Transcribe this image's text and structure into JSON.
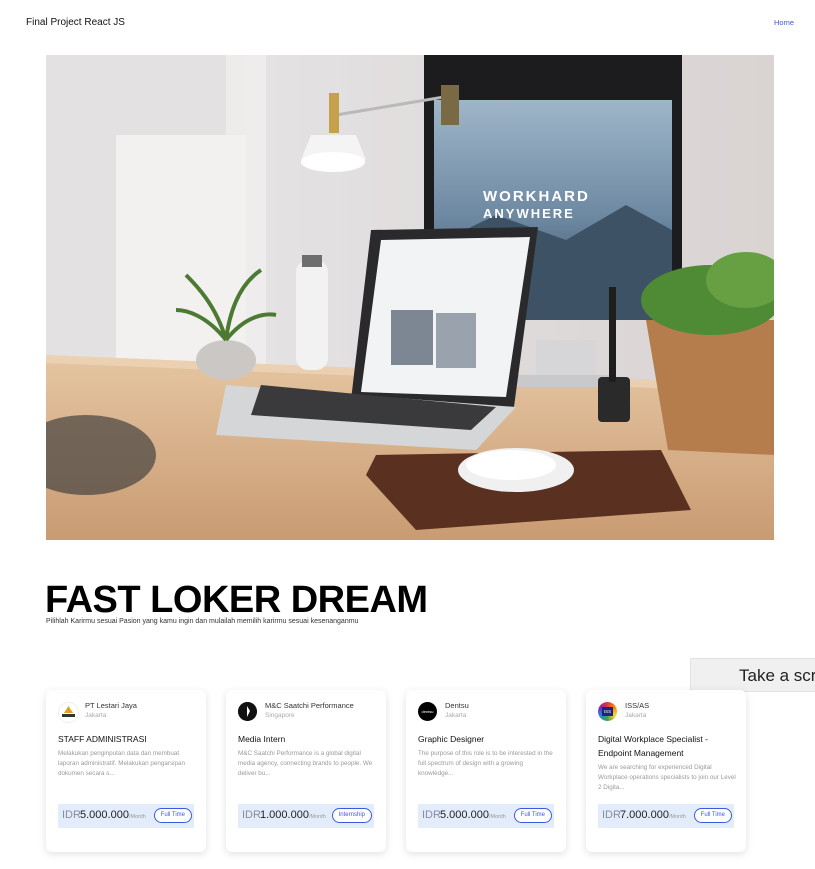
{
  "navbar": {
    "brand": "Final Project React JS",
    "home": "Home"
  },
  "hero": {
    "screen_text_line1": "WORKHARD",
    "screen_text_line2": "ANYWHERE"
  },
  "headline": {
    "title": "FAST LOKER DREAM",
    "subtitle": "Pilihlah Karirmu sesuai Pasion yang kamu ingin dan mulailah memilih karirmu sesuai kesenanganmu"
  },
  "screenshot_button": "Take a scr",
  "jobs": [
    {
      "company": "PT Lestari Jaya",
      "logo_text": "LESTARI",
      "location": "Jakarta",
      "title": "STAFF ADMINISTRASI",
      "description": "Melakukan penginputan data dan membuat laporan administratif. Melakukan pengarsipan dokumen secara s...",
      "currency": "IDR",
      "salary": "5.000.000",
      "per": "/Month",
      "type": "Full Time"
    },
    {
      "company": "M&C Saatchi Performance",
      "logo_text": "",
      "location": "Singapore",
      "title": "Media Intern",
      "description": "M&C Saatchi Performance is a global digital media agency, connecting brands to people. We deliver bu...",
      "currency": "IDR",
      "salary": "1.000.000",
      "per": "/Month",
      "type": "Internship"
    },
    {
      "company": "Dentsu",
      "logo_text": "dentsu",
      "location": "Jakarta",
      "title": "Graphic Designer",
      "description": "The purpose of this role is to be interested in the full spectrum of design with a growing knowledge...",
      "currency": "IDR",
      "salary": "5.000.000",
      "per": "/Month",
      "type": "Full Time"
    },
    {
      "company": "ISS/AS",
      "logo_text": "ISS",
      "location": "Jakarta",
      "title": "Digital Workplace Specialist - Endpoint Management",
      "description": "We are searching for experienced Digital Workplace operations specialists to join our Level 2 Digita...",
      "currency": "IDR",
      "salary": "7.000.000",
      "per": "/Month",
      "type": "Full Time"
    }
  ]
}
